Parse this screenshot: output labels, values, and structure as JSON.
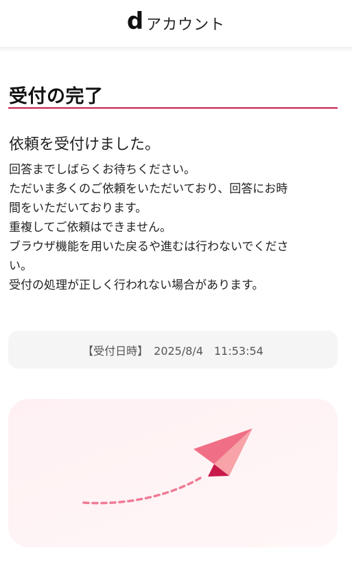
{
  "header": {
    "logo_letter": "d",
    "app_name": "アカウント"
  },
  "page": {
    "title": "受付の完了",
    "lead": "依頼を受付けました。",
    "body_lines": [
      "回答までしばらくお待ちください。",
      "ただいま多くのご依頼をいただいており、回答にお時",
      "間をいただいております。",
      "重複してご依頼はできません。",
      "ブラウザ機能を用いた戻るや進むは行わないでくださ",
      "い。",
      "受付の処理が正しく行われない場合があります。"
    ]
  },
  "receipt": {
    "label": "【受付日時】",
    "datetime": "2025/8/4　11:53:54"
  },
  "illustration": {
    "icon": "paper-plane-icon",
    "colors": {
      "plane_light": "#f7a3a8",
      "plane_mid": "#f06f86",
      "plane_dark": "#c8194b",
      "trail": "#f07a95"
    }
  },
  "colors": {
    "accent": "#c8194b",
    "box_bg": "#f5f5f5"
  }
}
